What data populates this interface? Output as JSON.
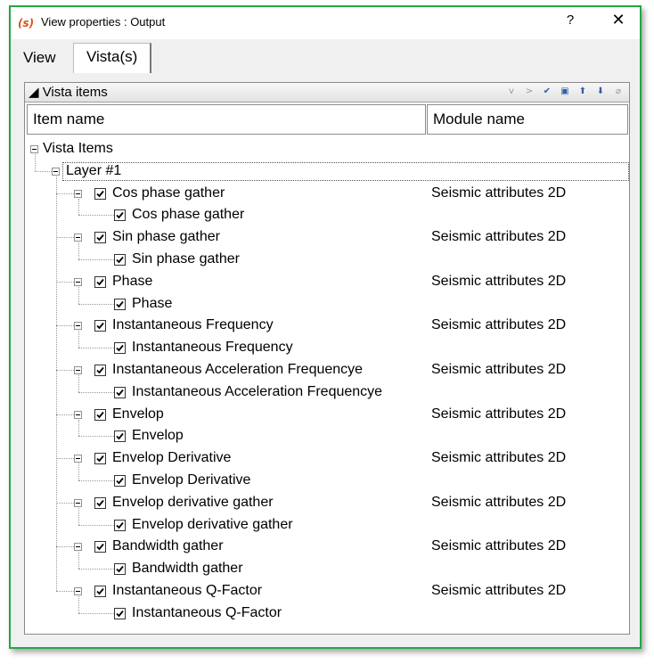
{
  "window": {
    "title": "View properties : Output",
    "help_glyph": "?",
    "close_glyph": "✕"
  },
  "tabs": [
    {
      "label": "View"
    },
    {
      "label": "Vista(s)",
      "selected": true
    }
  ],
  "panel": {
    "title": "◢ Vista items",
    "tools": [
      "chevron-down-icon",
      "chevron-right-icon",
      "check-icon",
      "copy-icon",
      "move-up-icon",
      "move-down-icon",
      "clear-icon"
    ]
  },
  "columns": {
    "item": "Item name",
    "module": "Module name"
  },
  "tree": {
    "root": "Vista Items",
    "layer": "Layer  #1",
    "items": [
      {
        "name": "Cos phase gather",
        "module": "Seismic attributes 2D",
        "child": "Cos phase gather"
      },
      {
        "name": "Sin phase gather",
        "module": "Seismic attributes 2D",
        "child": "Sin phase gather"
      },
      {
        "name": "Phase",
        "module": "Seismic attributes 2D",
        "child": "Phase"
      },
      {
        "name": "Instantaneous Frequency",
        "module": "Seismic attributes 2D",
        "child": "Instantaneous Frequency"
      },
      {
        "name": "Instantaneous Acceleration Frequencye",
        "module": "Seismic attributes 2D",
        "child": "Instantaneous Acceleration Frequencye"
      },
      {
        "name": "Envelop",
        "module": "Seismic attributes 2D",
        "child": "Envelop"
      },
      {
        "name": "Envelop Derivative",
        "module": "Seismic attributes 2D",
        "child": "Envelop Derivative"
      },
      {
        "name": "Envelop derivative gather",
        "module": "Seismic attributes 2D",
        "child": "Envelop derivative gather"
      },
      {
        "name": "Bandwidth gather",
        "module": "Seismic attributes 2D",
        "child": "Bandwidth gather"
      },
      {
        "name": "Instantaneous Q-Factor",
        "module": "Seismic attributes 2D",
        "child": "Instantaneous Q-Factor"
      }
    ]
  },
  "colors": {
    "window_border": "#22a845",
    "tool_icon": "#2f5fa8"
  }
}
